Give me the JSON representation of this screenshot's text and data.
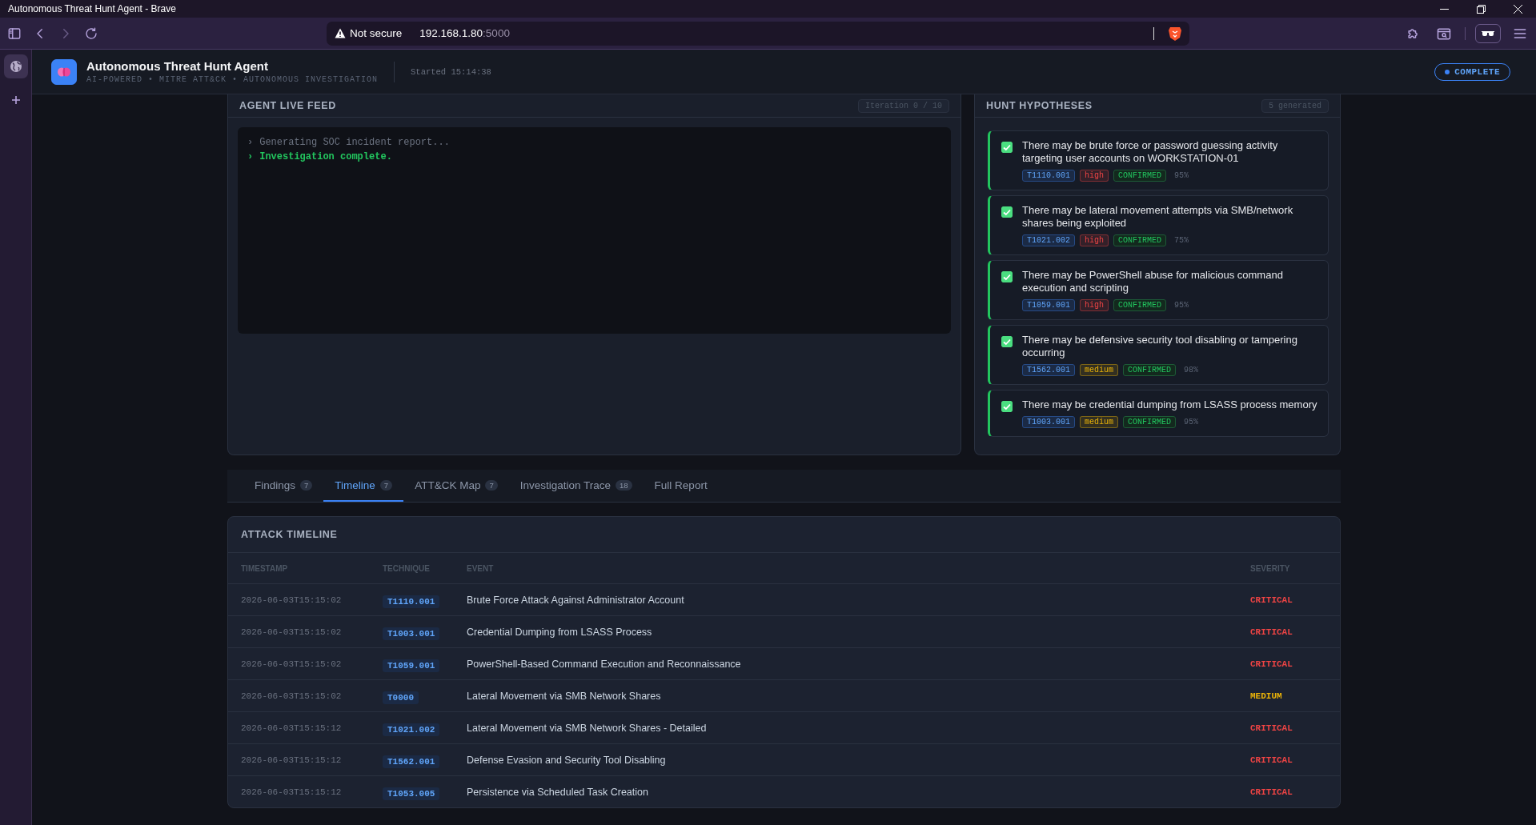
{
  "window": {
    "title": "Autonomous Threat Hunt Agent - Brave"
  },
  "browser": {
    "security": "Not secure",
    "url_host": "192.168.1.80",
    "url_port": ":5000"
  },
  "header": {
    "title": "Autonomous Threat Hunt Agent",
    "subtitle": "AI-POWERED • MITRE ATT&CK • AUTONOMOUS INVESTIGATION",
    "started": "Started 15:14:38",
    "status": "COMPLETE"
  },
  "live_feed": {
    "title": "AGENT LIVE FEED",
    "iteration": "Iteration 0 / 10",
    "lines": [
      {
        "prompt": "›",
        "text": "Generating SOC incident report...",
        "kind": "info"
      },
      {
        "prompt": "›",
        "text": "Investigation complete.",
        "kind": "success"
      }
    ]
  },
  "hypotheses": {
    "title": "HUNT HYPOTHESES",
    "count": "5 generated",
    "items": [
      {
        "text": "There may be brute force or password guessing activity targeting user accounts on WORKSTATION-01",
        "checked": true,
        "technique": "T1110.001",
        "priority": {
          "label": "high",
          "color": "#ef4444"
        },
        "status": "CONFIRMED",
        "confidence": "95%"
      },
      {
        "text": "There may be lateral movement attempts via SMB/network shares being exploited",
        "checked": true,
        "technique": "T1021.002",
        "priority": {
          "label": "high",
          "color": "#ef4444"
        },
        "status": "CONFIRMED",
        "confidence": "75%"
      },
      {
        "text": "There may be PowerShell abuse for malicious command execution and scripting",
        "checked": true,
        "technique": "T1059.001",
        "priority": {
          "label": "high",
          "color": "#ef4444"
        },
        "status": "CONFIRMED",
        "confidence": "95%"
      },
      {
        "text": "There may be defensive security tool disabling or tampering occurring",
        "checked": true,
        "technique": "T1562.001",
        "priority": {
          "label": "medium",
          "color": "#eab308"
        },
        "status": "CONFIRMED",
        "confidence": "98%"
      },
      {
        "text": "There may be credential dumping from LSASS process memory",
        "checked": true,
        "technique": "T1003.001",
        "priority": {
          "label": "medium",
          "color": "#eab308"
        },
        "status": "CONFIRMED",
        "confidence": "95%"
      }
    ]
  },
  "tabs": [
    {
      "label": "Findings",
      "count": "7",
      "selected": false
    },
    {
      "label": "Timeline",
      "count": "7",
      "selected": true
    },
    {
      "label": "ATT&CK Map",
      "count": "7",
      "selected": false
    },
    {
      "label": "Investigation Trace",
      "count": "18",
      "selected": false
    },
    {
      "label": "Full Report",
      "selected": false
    }
  ],
  "timeline": {
    "title": "ATTACK TIMELINE",
    "columns": [
      "TIMESTAMP",
      "TECHNIQUE",
      "EVENT",
      "SEVERITY"
    ],
    "rows": [
      {
        "timestamp": "2026-06-03T15:15:02",
        "technique": "T1110.001",
        "event": "Brute Force Attack Against Administrator Account",
        "severity": {
          "label": "CRITICAL",
          "color": "#ef4444"
        }
      },
      {
        "timestamp": "2026-06-03T15:15:02",
        "technique": "T1003.001",
        "event": "Credential Dumping from LSASS Process",
        "severity": {
          "label": "CRITICAL",
          "color": "#ef4444"
        }
      },
      {
        "timestamp": "2026-06-03T15:15:02",
        "technique": "T1059.001",
        "event": "PowerShell-Based Command Execution and Reconnaissance",
        "severity": {
          "label": "CRITICAL",
          "color": "#ef4444"
        }
      },
      {
        "timestamp": "2026-06-03T15:15:02",
        "technique": "T0000",
        "event": "Lateral Movement via SMB Network Shares",
        "severity": {
          "label": "MEDIUM",
          "color": "#eab308"
        }
      },
      {
        "timestamp": "2026-06-03T15:15:12",
        "technique": "T1021.002",
        "event": "Lateral Movement via SMB Network Shares - Detailed",
        "severity": {
          "label": "CRITICAL",
          "color": "#ef4444"
        }
      },
      {
        "timestamp": "2026-06-03T15:15:12",
        "technique": "T1562.001",
        "event": "Defense Evasion and Security Tool Disabling",
        "severity": {
          "label": "CRITICAL",
          "color": "#ef4444"
        }
      },
      {
        "timestamp": "2026-06-03T15:15:12",
        "technique": "T1053.005",
        "event": "Persistence via Scheduled Task Creation",
        "severity": {
          "label": "CRITICAL",
          "color": "#ef4444"
        }
      }
    ]
  }
}
